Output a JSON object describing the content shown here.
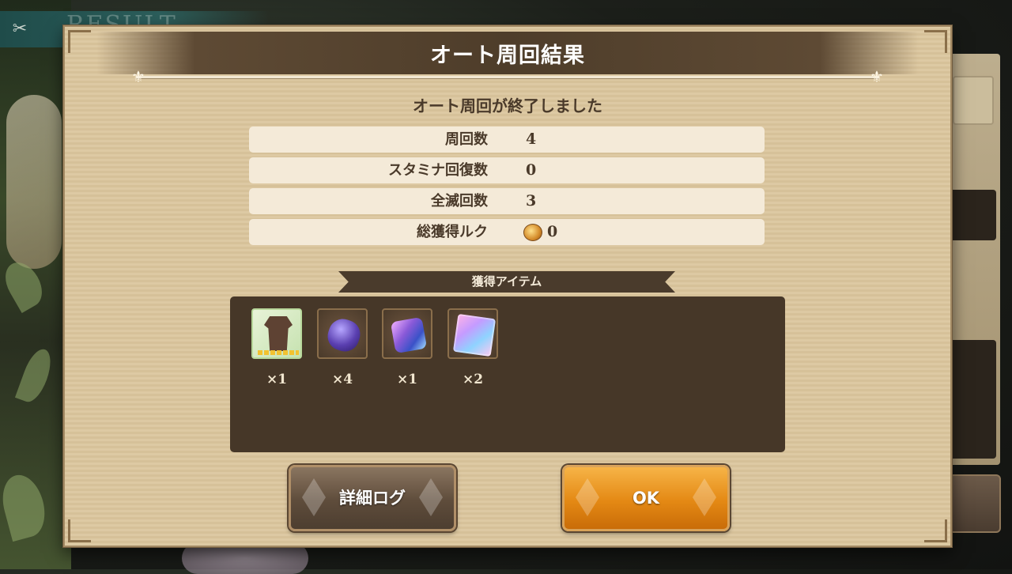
{
  "background": {
    "result_text": "RESULT",
    "back_icon": "back-arrow-icon"
  },
  "dialog": {
    "title": "オート周回結果",
    "subtitle": "オート周回が終了しました",
    "stats": [
      {
        "label": "周回数",
        "value": "4"
      },
      {
        "label": "スタミナ回復数",
        "value": "0"
      },
      {
        "label": "全滅回数",
        "value": "3"
      },
      {
        "label": "総獲得ルク",
        "value": "0",
        "icon": "ruk-coin-icon"
      }
    ],
    "items_header": "獲得アイテム",
    "items": [
      {
        "icon": "armor-item-icon",
        "qty": "×1"
      },
      {
        "icon": "purple-crystal-icon",
        "qty": "×4"
      },
      {
        "icon": "blue-crystal-icon",
        "qty": "×1"
      },
      {
        "icon": "rainbow-cube-icon",
        "qty": "×2"
      }
    ],
    "buttons": {
      "detail_log": "詳細ログ",
      "ok": "OK"
    }
  },
  "colors": {
    "panel": "#ddc9a3",
    "dark_box": "#463728",
    "ok_orange": "#e48914",
    "text_brown": "#4a3a2a"
  }
}
